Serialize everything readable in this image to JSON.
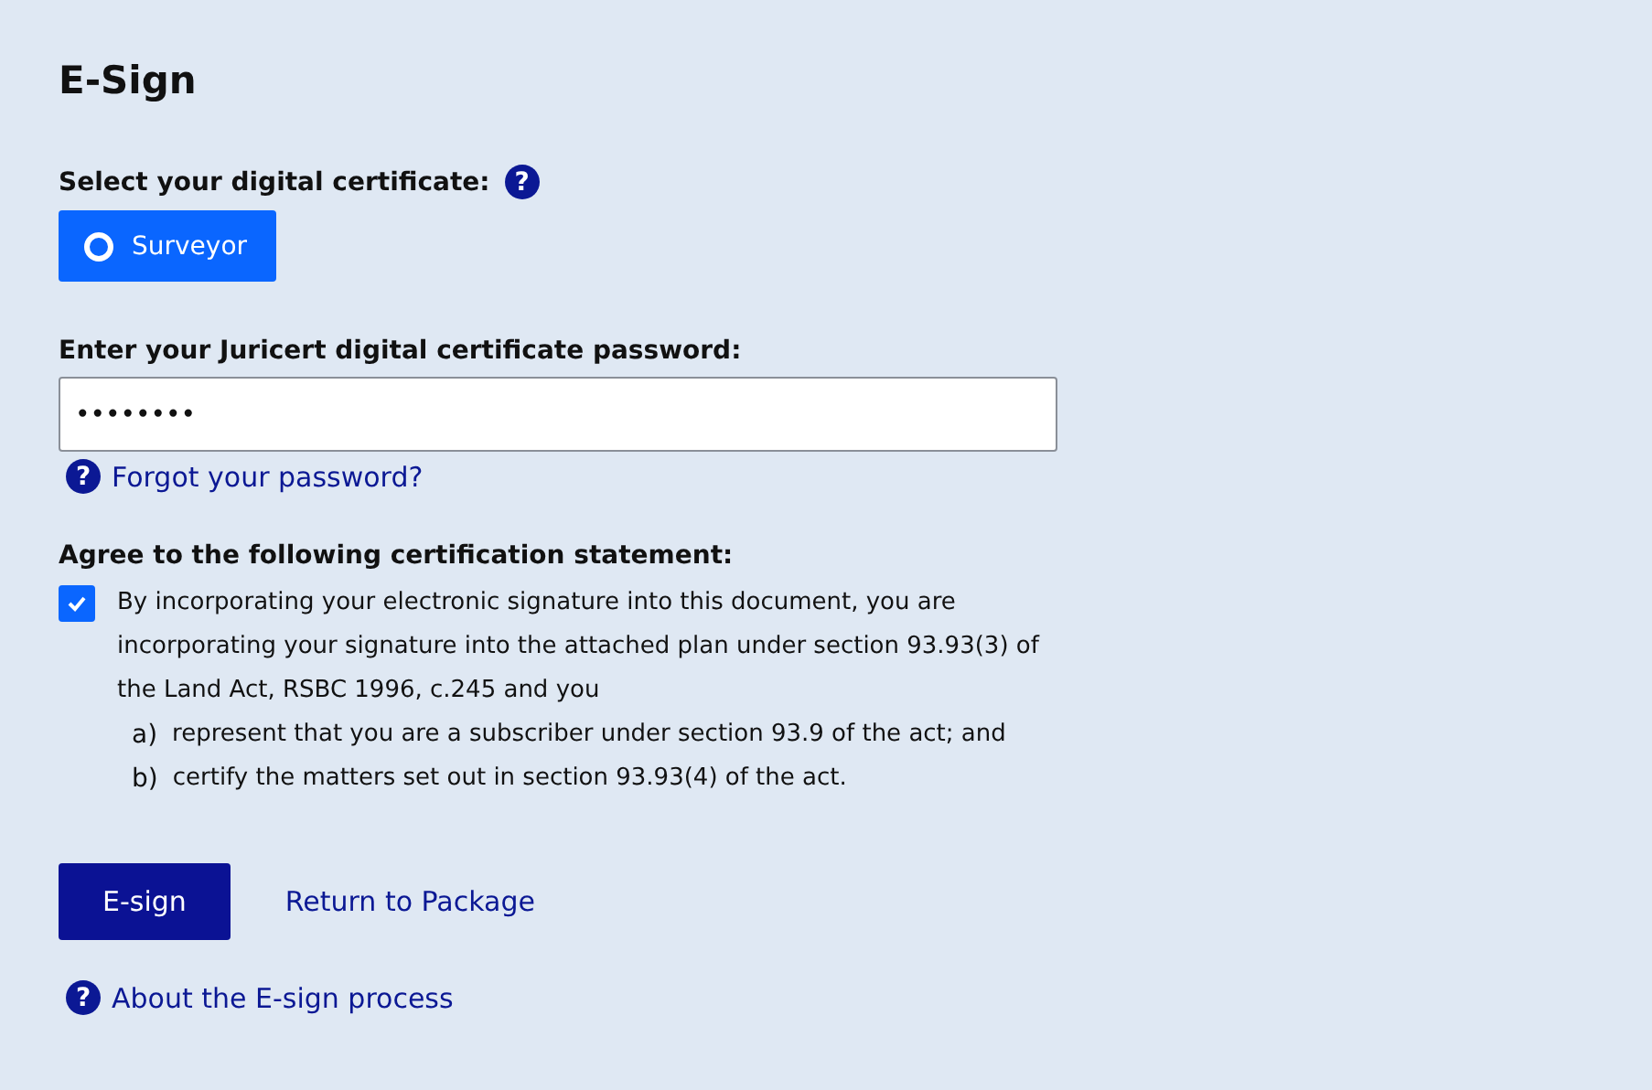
{
  "title": "E-Sign",
  "certificate": {
    "label": "Select your digital certificate:",
    "help_icon": "?",
    "options": [
      {
        "label": "Surveyor",
        "selected": true
      }
    ]
  },
  "password": {
    "label": "Enter your Juricert digital certificate password:",
    "value": "••••••••",
    "help_icon": "?",
    "forgot_link": "Forgot your password?"
  },
  "statement": {
    "label": "Agree to the following certification statement:",
    "checked": true,
    "text": "By incorporating your electronic signature into this document, you are incorporating your signature into the attached plan under section 93.93(3) of the Land Act, RSBC 1996, c.245 and you",
    "items": [
      {
        "marker": "a)",
        "text": "represent that you are a subscriber under section 93.9 of the act; and"
      },
      {
        "marker": "b)",
        "text": "certify the matters set out in section 93.93(4) of the act."
      }
    ]
  },
  "buttons": {
    "primary": "E-sign",
    "secondary": "Return to Package"
  },
  "about": {
    "help_icon": "?",
    "link": "About the E-sign process"
  }
}
